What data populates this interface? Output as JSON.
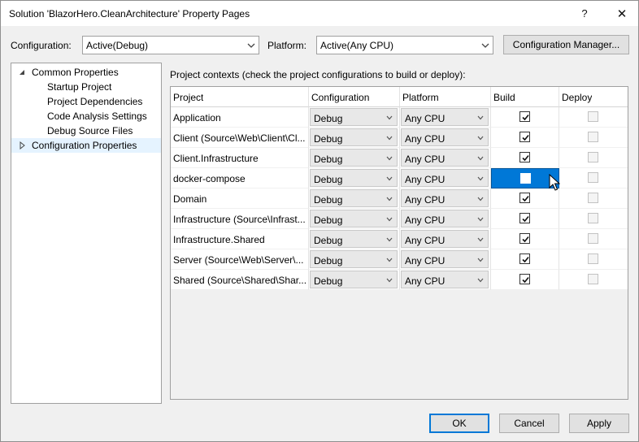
{
  "window": {
    "title": "Solution 'BlazorHero.CleanArchitecture' Property Pages",
    "help_glyph": "?",
    "close_glyph": "✕"
  },
  "toolbar": {
    "configuration_label": "Configuration:",
    "configuration_value": "Active(Debug)",
    "platform_label": "Platform:",
    "platform_value": "Active(Any CPU)",
    "config_manager_label": "Configuration Manager..."
  },
  "tree": {
    "root": "Common Properties",
    "children": [
      "Startup Project",
      "Project Dependencies",
      "Code Analysis Settings",
      "Debug Source Files"
    ],
    "second_root": "Configuration Properties"
  },
  "grid": {
    "caption": "Project contexts (check the project configurations to build or deploy):",
    "headers": {
      "project": "Project",
      "configuration": "Configuration",
      "platform": "Platform",
      "build": "Build",
      "deploy": "Deploy"
    },
    "rows": [
      {
        "project": "Application",
        "configuration": "Debug",
        "platform": "Any CPU",
        "build": true,
        "deploy": false
      },
      {
        "project": "Client (Source\\Web\\Client\\Cl...",
        "configuration": "Debug",
        "platform": "Any CPU",
        "build": true,
        "deploy": false
      },
      {
        "project": "Client.Infrastructure",
        "configuration": "Debug",
        "platform": "Any CPU",
        "build": true,
        "deploy": false
      },
      {
        "project": "docker-compose",
        "configuration": "Debug",
        "platform": "Any CPU",
        "build": false,
        "deploy": false
      },
      {
        "project": "Domain",
        "configuration": "Debug",
        "platform": "Any CPU",
        "build": true,
        "deploy": false
      },
      {
        "project": "Infrastructure (Source\\Infrast...",
        "configuration": "Debug",
        "platform": "Any CPU",
        "build": true,
        "deploy": false
      },
      {
        "project": "Infrastructure.Shared",
        "configuration": "Debug",
        "platform": "Any CPU",
        "build": true,
        "deploy": false
      },
      {
        "project": "Server (Source\\Web\\Server\\...",
        "configuration": "Debug",
        "platform": "Any CPU",
        "build": true,
        "deploy": false
      },
      {
        "project": "Shared (Source\\Shared\\Shar...",
        "configuration": "Debug",
        "platform": "Any CPU",
        "build": true,
        "deploy": false
      }
    ]
  },
  "footer": {
    "ok_label": "OK",
    "cancel_label": "Cancel",
    "apply_label": "Apply"
  },
  "colors": {
    "accent": "#0078d7",
    "selection": "#e5f3ff"
  }
}
